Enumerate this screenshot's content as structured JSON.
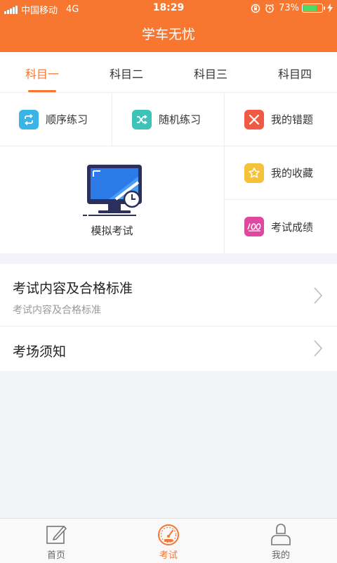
{
  "status": {
    "carrier": "中国移动",
    "network": "4G",
    "time": "18:29",
    "battery": "73%",
    "battery_level": 0.73
  },
  "header": {
    "title": "学车无忧"
  },
  "tabs": [
    {
      "label": "科目一",
      "active": true
    },
    {
      "label": "科目二",
      "active": false
    },
    {
      "label": "科目三",
      "active": false
    },
    {
      "label": "科目四",
      "active": false
    }
  ],
  "grid": {
    "sequential": {
      "label": "顺序练习",
      "icon": "loop-icon",
      "color": "#3bb3e7"
    },
    "random": {
      "label": "随机练习",
      "icon": "shuffle-icon",
      "color": "#3fc2b8"
    },
    "mistakes": {
      "label": "我的错题",
      "icon": "close-icon",
      "color": "#f05a44"
    },
    "mock_exam": {
      "label": "模拟考试",
      "icon": "monitor-clock-icon"
    },
    "favorites": {
      "label": "我的收藏",
      "icon": "star-icon",
      "color": "#f6c23b"
    },
    "scores": {
      "label": "考试成绩",
      "icon": "score-100-icon",
      "color": "#e0479e"
    }
  },
  "list": [
    {
      "title": "考试内容及合格标准",
      "subtitle": "考试内容及合格标准"
    },
    {
      "title": "考场须知"
    }
  ],
  "bottom_nav": [
    {
      "label": "首页",
      "icon": "edit-icon",
      "active": false
    },
    {
      "label": "考试",
      "icon": "speedometer-icon",
      "active": true
    },
    {
      "label": "我的",
      "icon": "user-icon",
      "active": false
    }
  ],
  "colors": {
    "accent": "#f77730",
    "background": "#f2f4f7"
  }
}
